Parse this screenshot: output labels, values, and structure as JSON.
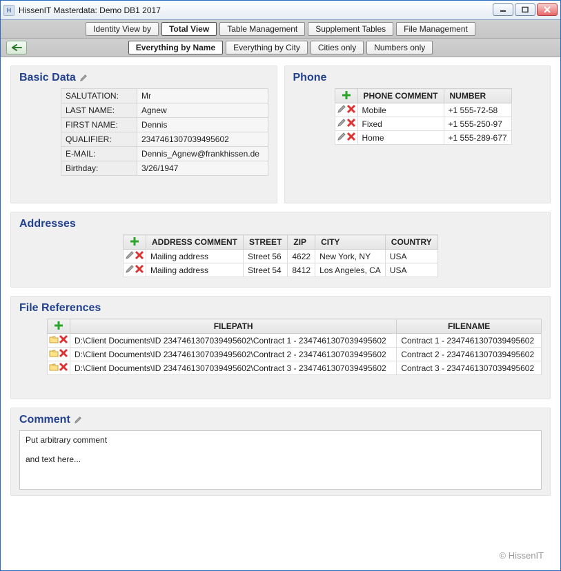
{
  "window": {
    "title": "HissenIT Masterdata: Demo DB1 2017",
    "icon_letter": "H"
  },
  "main_tabs": {
    "items": [
      {
        "label": "Identity View by",
        "active": false
      },
      {
        "label": "Total View",
        "active": true
      },
      {
        "label": "Table Management",
        "active": false
      },
      {
        "label": "Supplement Tables",
        "active": false
      },
      {
        "label": "File Management",
        "active": false
      }
    ]
  },
  "sub_tabs": {
    "items": [
      {
        "label": "Everything by Name",
        "active": true
      },
      {
        "label": "Everything by City",
        "active": false
      },
      {
        "label": "Cities only",
        "active": false
      },
      {
        "label": "Numbers only",
        "active": false
      }
    ]
  },
  "basic_data": {
    "title": "Basic Data",
    "fields": [
      {
        "label": "SALUTATION:",
        "value": "Mr"
      },
      {
        "label": "LAST NAME:",
        "value": "Agnew"
      },
      {
        "label": "FIRST NAME:",
        "value": "Dennis"
      },
      {
        "label": "QUALIFIER:",
        "value": "2347461307039495602"
      },
      {
        "label": "E-MAIL:",
        "value": "Dennis_Agnew@frankhissen.de"
      },
      {
        "label": "Birthday:",
        "value": "3/26/1947"
      }
    ]
  },
  "phone": {
    "title": "Phone",
    "headers": [
      "PHONE COMMENT",
      "NUMBER"
    ],
    "rows": [
      {
        "comment": "Mobile",
        "number": "+1 555-72-58"
      },
      {
        "comment": "Fixed",
        "number": "+1 555-250-97"
      },
      {
        "comment": "Home",
        "number": "+1 555-289-677"
      }
    ]
  },
  "addresses": {
    "title": "Addresses",
    "headers": [
      "ADDRESS COMMENT",
      "STREET",
      "ZIP",
      "CITY",
      "COUNTRY"
    ],
    "rows": [
      {
        "comment": "Mailing address",
        "street": "Street 56",
        "zip": "4622",
        "city": "New York, NY",
        "country": "USA"
      },
      {
        "comment": "Mailing address",
        "street": "Street 54",
        "zip": "8412",
        "city": "Los Angeles, CA",
        "country": "USA"
      }
    ]
  },
  "files": {
    "title": "File References",
    "headers": [
      "FILEPATH",
      "FILENAME"
    ],
    "rows": [
      {
        "path": "D:\\Client Documents\\ID 2347461307039495602\\Contract 1 - 2347461307039495602",
        "name": "Contract 1 - 2347461307039495602"
      },
      {
        "path": "D:\\Client Documents\\ID 2347461307039495602\\Contract 2 - 2347461307039495602",
        "name": "Contract 2 - 2347461307039495602"
      },
      {
        "path": "D:\\Client Documents\\ID 2347461307039495602\\Contract 3 - 2347461307039495602",
        "name": "Contract 3 - 2347461307039495602"
      }
    ]
  },
  "comment": {
    "title": "Comment",
    "text": "Put arbitrary comment\n\nand text here..."
  },
  "footer": "© HissenIT"
}
